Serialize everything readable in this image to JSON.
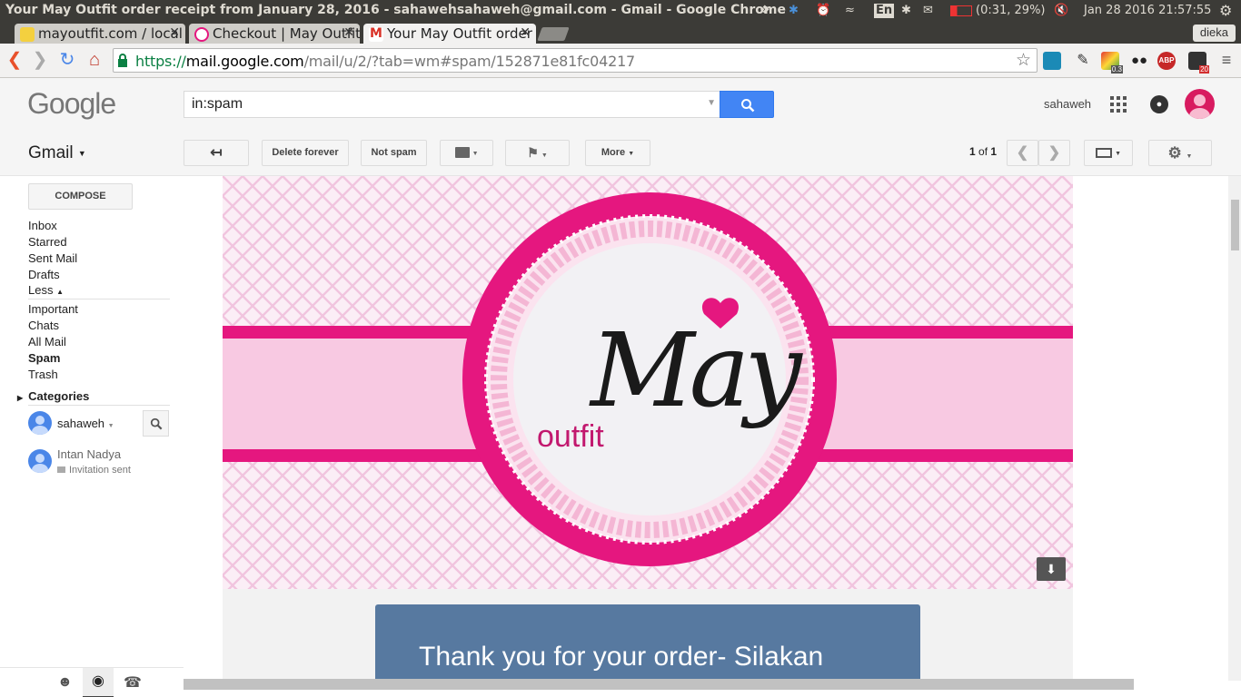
{
  "os": {
    "window_title": "Your May Outfit order receipt from January 28, 2016 - sahawehsahaweh@gmail.com - Gmail - Google Chrome",
    "keyboard": "En",
    "battery": "(0:31, 29%)",
    "datetime": "Jan 28 2016 21:57:55"
  },
  "browser": {
    "tabs": [
      {
        "label": "mayoutfit.com / local",
        "active": false
      },
      {
        "label": "Checkout | May Outfit",
        "active": false
      },
      {
        "label": "Your May Outfit order",
        "active": true
      }
    ],
    "profile": "dieka",
    "url": {
      "scheme": "https://",
      "host": "mail.google.com",
      "path": "/mail/u/2/?tab=wm#spam/152871e81fc04217"
    },
    "ext_badges": {
      "speed": "0.3",
      "mail": "20"
    }
  },
  "gmail": {
    "logo": "Google",
    "search_value": "in:spam",
    "account": "sahaweh",
    "app_label": "Gmail",
    "toolbar": {
      "delete_forever": "Delete forever",
      "not_spam": "Not spam",
      "more": "More",
      "pager_current": "1",
      "pager_of": "of",
      "pager_total": "1"
    },
    "compose": "COMPOSE",
    "nav": {
      "inbox": "Inbox",
      "starred": "Starred",
      "sent": "Sent Mail",
      "drafts": "Drafts",
      "less": "Less",
      "important": "Important",
      "chats": "Chats",
      "all_mail": "All Mail",
      "spam": "Spam",
      "trash": "Trash",
      "categories": "Categories"
    },
    "hangouts": {
      "me": "sahaweh",
      "contact_name": "Intan Nadya",
      "contact_status": "Invitation sent"
    }
  },
  "email": {
    "brand_script": "May",
    "brand_sub": "outfit",
    "thanks": "Thank you for your order- Silakan"
  },
  "colors": {
    "brand_pink": "#e5177f",
    "gmail_blue": "#4285f4",
    "email_blue": "#5779a0"
  }
}
